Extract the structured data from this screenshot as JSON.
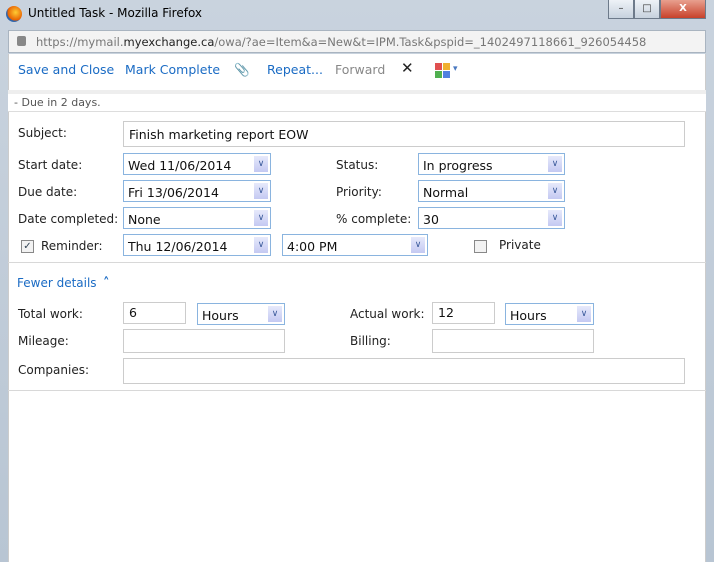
{
  "window": {
    "title": "Untitled Task - Mozilla Firefox",
    "minimize": "–",
    "maximize": "□",
    "close": "X"
  },
  "url": {
    "prefix": "https://mymail.",
    "domain": "myexchange.ca",
    "path": "/owa/?ae=Item&a=New&t=IPM.Task&pspid=_1402497118661_926054458"
  },
  "toolbar": {
    "save": "Save and Close",
    "complete": "Mark Complete",
    "attach": "📎",
    "repeat": "Repeat...",
    "forward": "Forward",
    "delete": "✕",
    "categorize_arrow": "▾"
  },
  "infobar": {
    "text": "Due in 2 days.",
    "bullet": "-"
  },
  "form": {
    "subject": {
      "label": "Subject:",
      "value": "Finish marketing report EOW"
    },
    "start": {
      "label": "Start date:",
      "value": "Wed 11/06/2014"
    },
    "due": {
      "label": "Due date:",
      "value": "Fri 13/06/2014"
    },
    "completed": {
      "label": "Date completed:",
      "value": "None"
    },
    "status": {
      "label": "Status:",
      "value": "In progress"
    },
    "priority": {
      "label": "Priority:",
      "value": "Normal"
    },
    "percent": {
      "label": "% complete:",
      "value": "30"
    },
    "reminder": {
      "label": "Reminder:",
      "checked": true,
      "date": "Thu 12/06/2014",
      "time": "4:00 PM",
      "check": "✓"
    },
    "private": {
      "label": "Private",
      "checked": false
    }
  },
  "details": {
    "toggle": "Fewer details",
    "toggle_icon": "˄",
    "total_work": {
      "label": "Total work:",
      "value": "6",
      "unit": "Hours"
    },
    "actual_work": {
      "label": "Actual work:",
      "value": "12",
      "unit": "Hours"
    },
    "mileage": {
      "label": "Mileage:",
      "value": ""
    },
    "billing": {
      "label": "Billing:",
      "value": ""
    },
    "companies": {
      "label": "Companies:",
      "value": ""
    }
  },
  "dropdown_icon": "∨"
}
